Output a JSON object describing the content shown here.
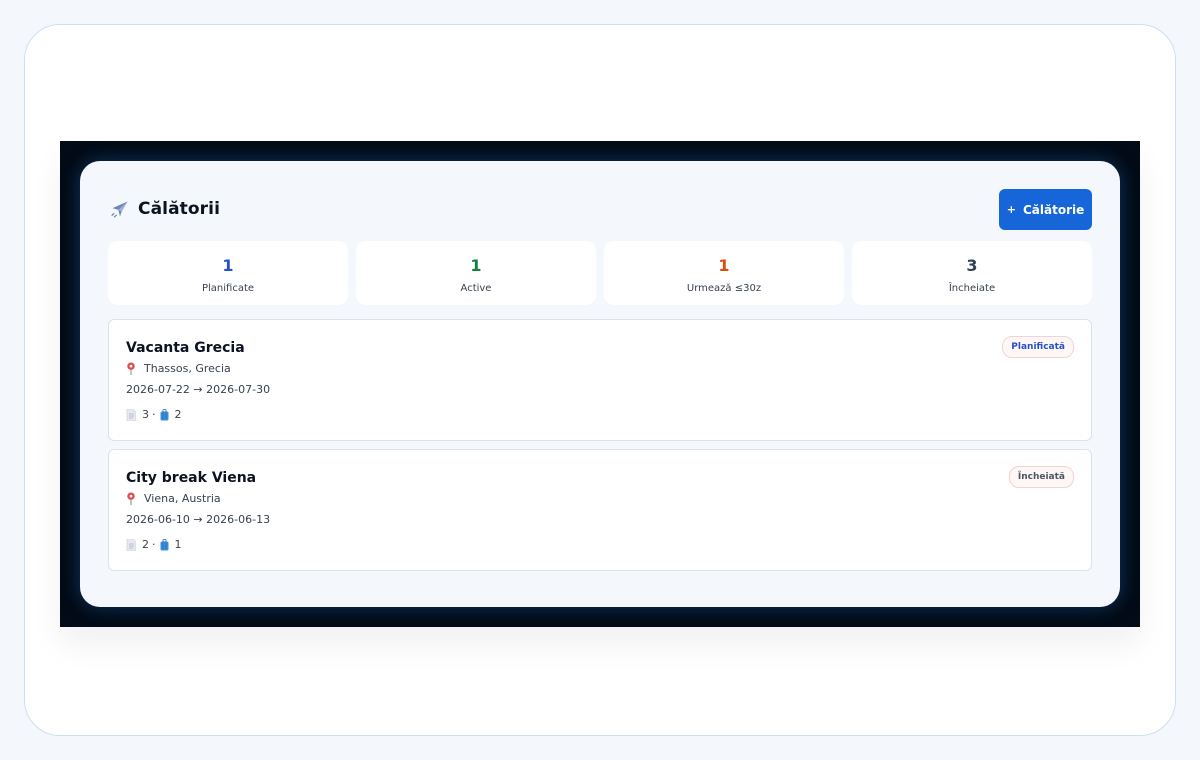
{
  "header": {
    "title": "Călătorii",
    "icon": "airplane-icon",
    "add_button_plus": "+",
    "add_button_label": "Călătorie"
  },
  "stats": [
    {
      "value": "1",
      "label": "Planificate",
      "color": "#2552c6"
    },
    {
      "value": "1",
      "label": "Active",
      "color": "#15803d"
    },
    {
      "value": "1",
      "label": "Urmează ≤30z",
      "color": "#d9500d"
    },
    {
      "value": "3",
      "label": "Încheiate",
      "color": "#334155"
    }
  ],
  "trips": [
    {
      "name": "Vacanta Grecia",
      "location": "Thassos, Grecia",
      "dates": "2026-07-22 → 2026-07-30",
      "documents": "3",
      "separator": "·",
      "luggage": "2",
      "status": "Planificată",
      "status_color": "#2552c6"
    },
    {
      "name": "City break Viena",
      "location": "Viena, Austria",
      "dates": "2026-06-10 → 2026-06-13",
      "documents": "2",
      "separator": "·",
      "luggage": "1",
      "status": "Încheiată",
      "status_color": "#4b5563"
    }
  ],
  "colors": {
    "accent": "#1766d9",
    "stage": "#020b16",
    "panel": "#f4f7fb"
  }
}
